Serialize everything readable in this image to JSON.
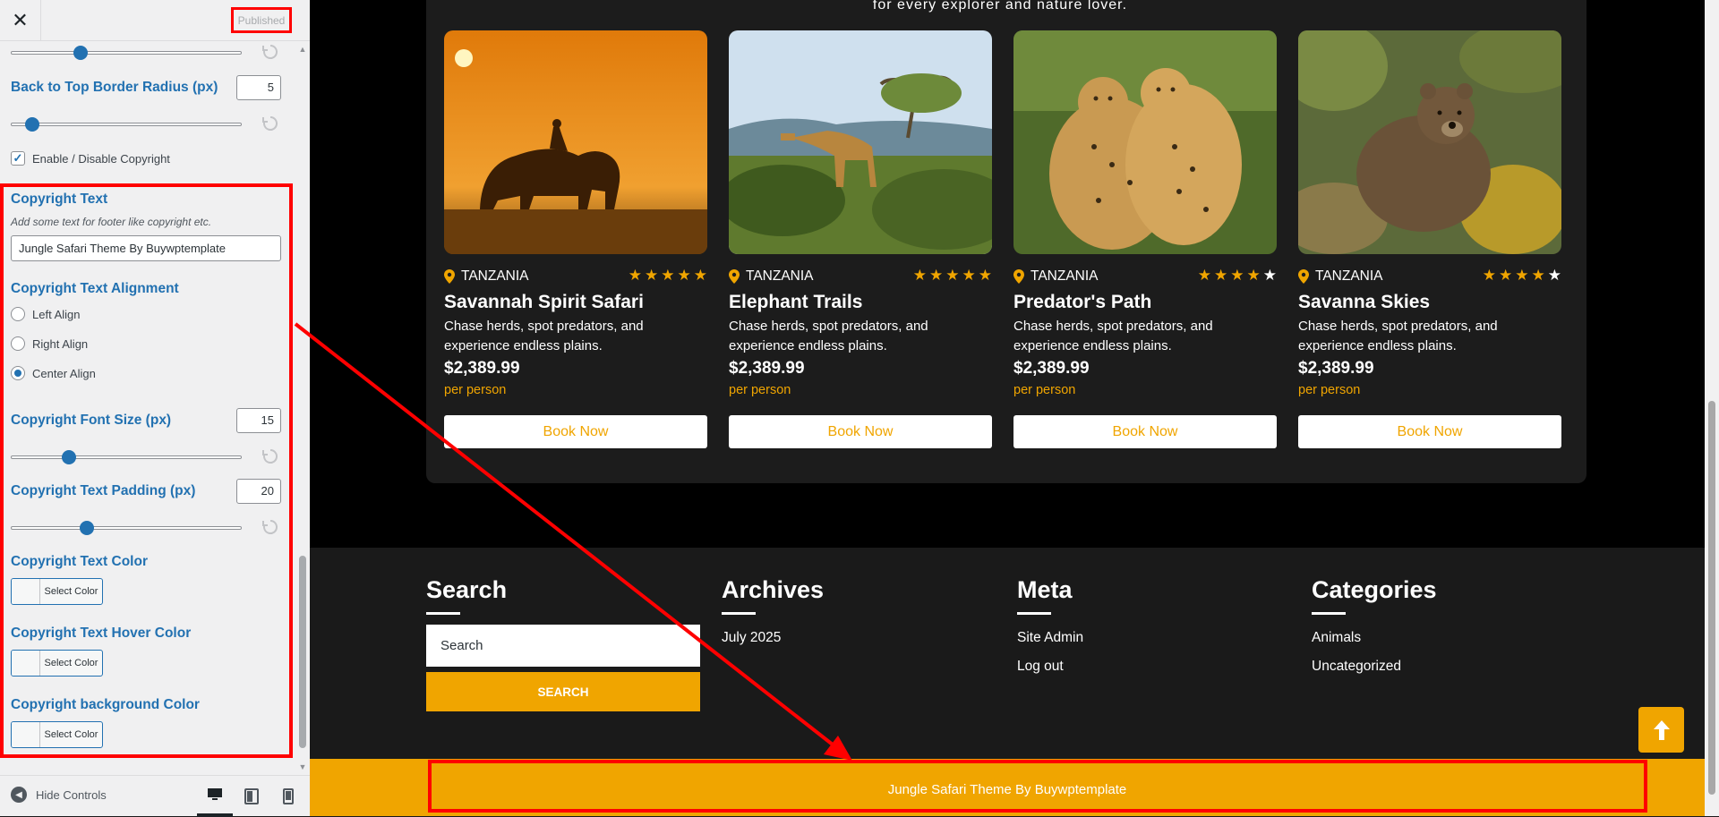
{
  "panel": {
    "close_glyph": "✕",
    "publish_status": "Published",
    "back_to_top_radius": {
      "label": "Back to Top Border Radius (px)",
      "value": "5",
      "slider_fraction": 0.09
    },
    "top_slider_fraction": 0.3,
    "copyright_toggle": {
      "label": "Enable / Disable Copyright",
      "checked": true
    },
    "copyright_text": {
      "label": "Copyright Text",
      "description": "Add some text for footer like copyright etc.",
      "value": "Jungle Safari Theme By Buywptemplate"
    },
    "alignment": {
      "label": "Copyright Text Alignment",
      "options": [
        {
          "label": "Left Align",
          "selected": false
        },
        {
          "label": "Right Align",
          "selected": false
        },
        {
          "label": "Center Align",
          "selected": true
        }
      ]
    },
    "font_size": {
      "label": "Copyright Font Size (px)",
      "value": "15",
      "slider_fraction": 0.3
    },
    "padding": {
      "label": "Copyright Text Padding (px)",
      "value": "20",
      "slider_fraction": 0.4
    },
    "text_color": {
      "label": "Copyright Text Color",
      "button": "Select Color"
    },
    "hover_color": {
      "label": "Copyright Text Hover Color",
      "button": "Select Color"
    },
    "bg_color": {
      "label": "Copyright background Color",
      "button": "Select Color"
    },
    "footer": {
      "hide_controls": "Hide Controls"
    }
  },
  "preview": {
    "tagline": "for every explorer and nature lover.",
    "tours": [
      {
        "location": "TANZANIA",
        "rating": 5,
        "title": "Savannah Spirit Safari",
        "desc": "Chase herds, spot predators, and experience endless plains.",
        "price": "$2,389.99",
        "per": "per person",
        "button": "Book Now",
        "image": "elephant-sunset"
      },
      {
        "location": "TANZANIA",
        "rating": 5,
        "title": "Elephant Trails",
        "desc": "Chase herds, spot predators, and experience endless plains.",
        "price": "$2,389.99",
        "per": "per person",
        "button": "Book Now",
        "image": "giraffe"
      },
      {
        "location": "TANZANIA",
        "rating": 4,
        "title": "Predator's Path",
        "desc": "Chase herds, spot predators, and experience endless plains.",
        "price": "$2,389.99",
        "per": "per person",
        "button": "Book Now",
        "image": "cheetahs"
      },
      {
        "location": "TANZANIA",
        "rating": 4,
        "title": "Savanna Skies",
        "desc": "Chase herds, spot predators, and experience endless plains.",
        "price": "$2,389.99",
        "per": "per person",
        "button": "Book Now",
        "image": "bear"
      }
    ],
    "widgets": {
      "search": {
        "title": "Search",
        "placeholder": "Search",
        "button": "SEARCH"
      },
      "archives": {
        "title": "Archives",
        "items": [
          "July 2025"
        ]
      },
      "meta": {
        "title": "Meta",
        "items": [
          "Site Admin",
          "Log out"
        ]
      },
      "categories": {
        "title": "Categories",
        "items": [
          "Animals",
          "Uncategorized"
        ]
      }
    },
    "copyright": "Jungle Safari Theme By Buywptemplate",
    "accent_color": "#f0a500"
  }
}
